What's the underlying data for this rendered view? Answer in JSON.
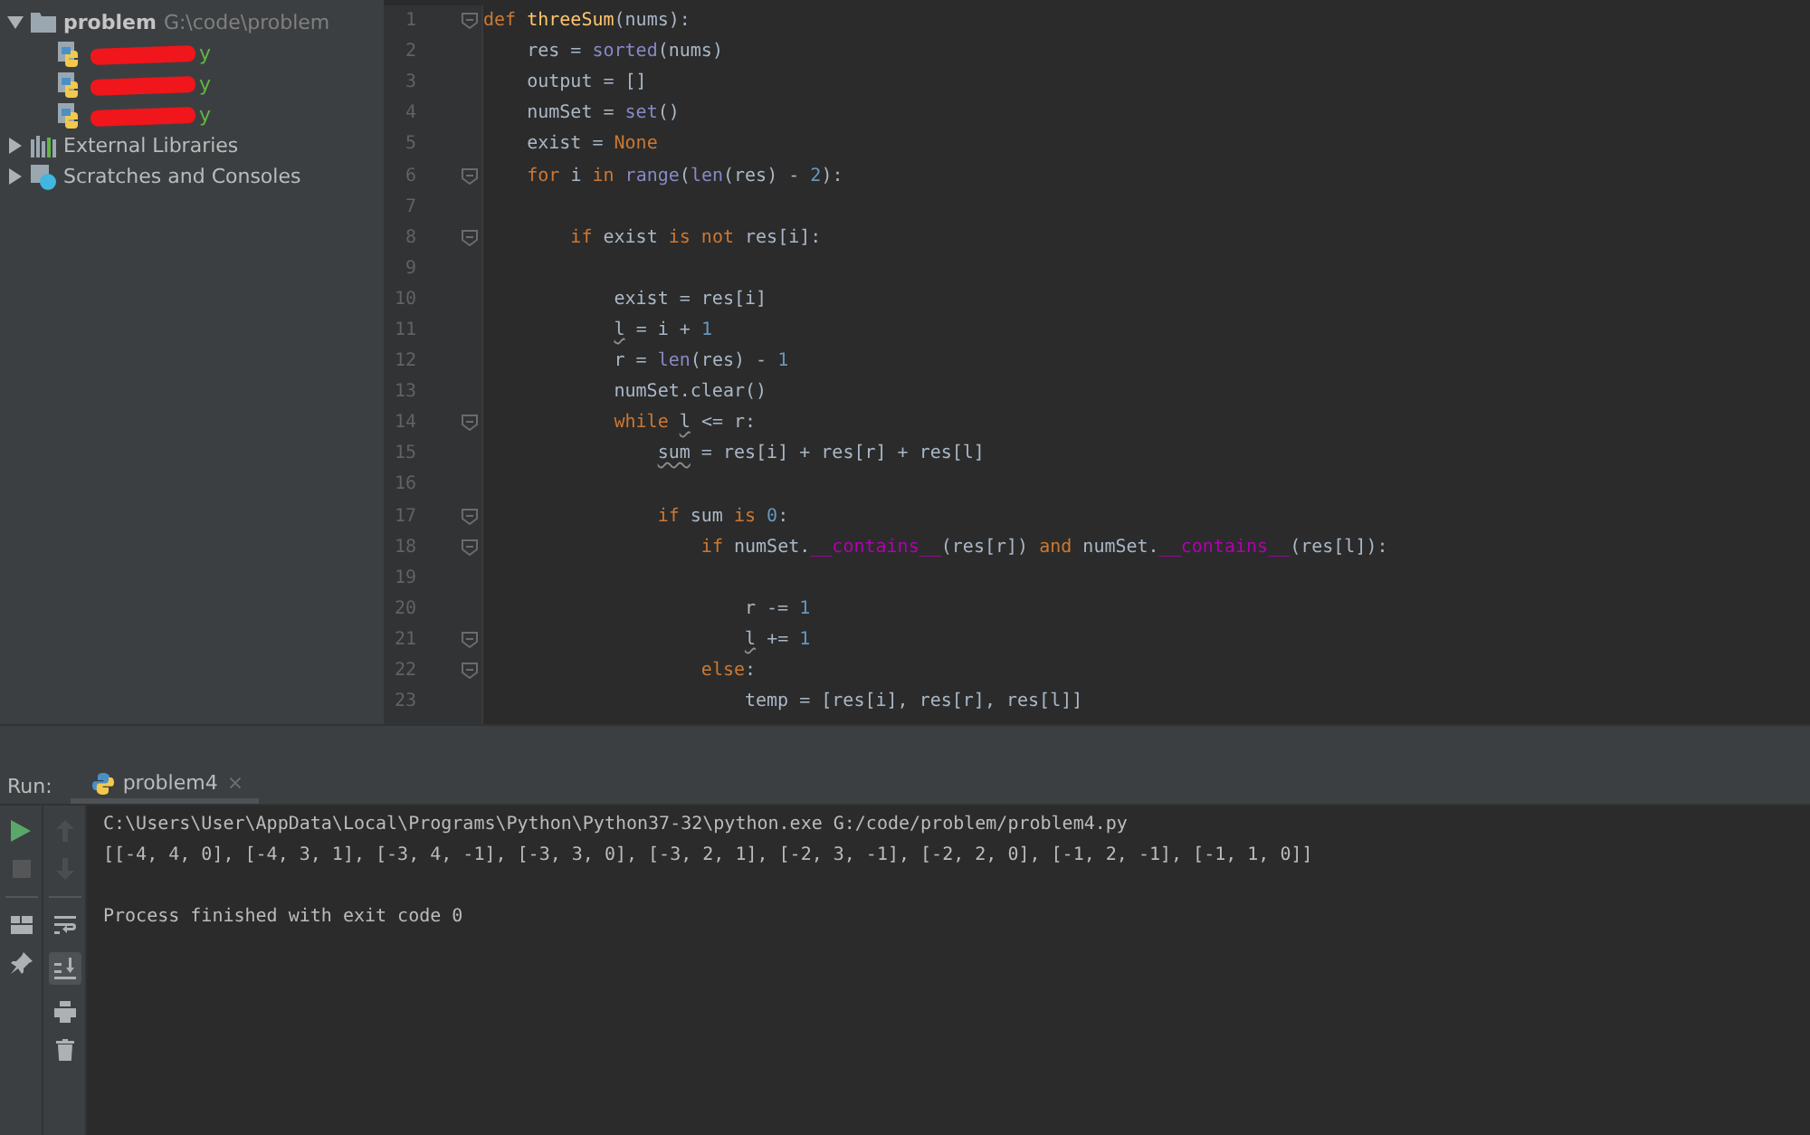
{
  "project": {
    "root": {
      "name": "problem",
      "path": "G:\\code\\problem",
      "expanded": true,
      "files": [
        {
          "visible_text": "y",
          "redacted": true
        },
        {
          "visible_text": "y",
          "redacted": true
        },
        {
          "visible_text": "y",
          "redacted": true
        }
      ]
    },
    "nodes": [
      {
        "kind": "libraries",
        "label": "External Libraries",
        "expanded": false
      },
      {
        "kind": "scratches",
        "label": "Scratches and Consoles",
        "expanded": false
      }
    ]
  },
  "editor": {
    "lines": [
      {
        "number": "1",
        "fold": true,
        "tokens": [
          {
            "t": "def ",
            "kind": "kw"
          },
          {
            "t": "threeSum",
            "kind": "def"
          },
          {
            "t": "(nums):",
            "kind": "plain"
          }
        ]
      },
      {
        "number": "2",
        "tokens": [
          {
            "t": "    res = ",
            "kind": "plain"
          },
          {
            "t": "sorted",
            "kind": "builtin"
          },
          {
            "t": "(nums)",
            "kind": "plain"
          }
        ]
      },
      {
        "number": "3",
        "tokens": [
          {
            "t": "    output = []",
            "kind": "plain"
          }
        ]
      },
      {
        "number": "4",
        "tokens": [
          {
            "t": "    numSet = ",
            "kind": "plain"
          },
          {
            "t": "set",
            "kind": "builtin"
          },
          {
            "t": "()",
            "kind": "plain"
          }
        ]
      },
      {
        "number": "5",
        "tokens": [
          {
            "t": "    exist = ",
            "kind": "plain"
          },
          {
            "t": "None",
            "kind": "kw"
          }
        ]
      },
      {
        "number": "6",
        "fold": true,
        "tokens": [
          {
            "t": "    for ",
            "kind": "kw"
          },
          {
            "t": "i ",
            "kind": "plain"
          },
          {
            "t": "in ",
            "kind": "kw"
          },
          {
            "t": "range",
            "kind": "builtin"
          },
          {
            "t": "(",
            "kind": "plain"
          },
          {
            "t": "len",
            "kind": "builtin"
          },
          {
            "t": "(res) - ",
            "kind": "plain"
          },
          {
            "t": "2",
            "kind": "num"
          },
          {
            "t": "):",
            "kind": "plain"
          }
        ]
      },
      {
        "number": "7"
      },
      {
        "number": "8",
        "fold": true,
        "tokens": [
          {
            "t": "        if ",
            "kind": "kw"
          },
          {
            "t": "exist ",
            "kind": "plain"
          },
          {
            "t": "is not ",
            "kind": "kw"
          },
          {
            "t": "res[i]:",
            "kind": "plain"
          }
        ]
      },
      {
        "number": "9"
      },
      {
        "number": "10",
        "tokens": [
          {
            "t": "            exist = res[i]",
            "kind": "plain"
          }
        ]
      },
      {
        "number": "11",
        "tokens": [
          {
            "t": "            l",
            "kind": "warn"
          },
          {
            "t": " = i + ",
            "kind": "plain"
          },
          {
            "t": "1",
            "kind": "num"
          }
        ]
      },
      {
        "number": "12",
        "tokens": [
          {
            "t": "            r = ",
            "kind": "plain"
          },
          {
            "t": "len",
            "kind": "builtin"
          },
          {
            "t": "(res) - ",
            "kind": "plain"
          },
          {
            "t": "1",
            "kind": "num"
          }
        ]
      },
      {
        "number": "13",
        "tokens": [
          {
            "t": "            numSet.clear()",
            "kind": "plain"
          }
        ]
      },
      {
        "number": "14",
        "fold": true,
        "tokens": [
          {
            "t": "            while ",
            "kind": "kw"
          },
          {
            "t": "l",
            "kind": "warn"
          },
          {
            "t": " <= r:",
            "kind": "plain"
          }
        ]
      },
      {
        "number": "15",
        "tokens": [
          {
            "t": "                sum",
            "kind": "warn"
          },
          {
            "t": " = res[i] + res[r] + res[l]",
            "kind": "plain"
          }
        ]
      },
      {
        "number": "16"
      },
      {
        "number": "17",
        "fold": true,
        "tokens": [
          {
            "t": "                if ",
            "kind": "kw"
          },
          {
            "t": "sum ",
            "kind": "plain"
          },
          {
            "t": "is ",
            "kind": "kw"
          },
          {
            "t": "0",
            "kind": "num"
          },
          {
            "t": ":",
            "kind": "plain"
          }
        ]
      },
      {
        "number": "18",
        "fold": true,
        "tokens": [
          {
            "t": "                    if ",
            "kind": "kw"
          },
          {
            "t": "numSet.",
            "kind": "plain"
          },
          {
            "t": "__contains__",
            "kind": "magic"
          },
          {
            "t": "(res[r]) ",
            "kind": "plain"
          },
          {
            "t": "and ",
            "kind": "kw"
          },
          {
            "t": "numSet.",
            "kind": "plain"
          },
          {
            "t": "__contains__",
            "kind": "magic"
          },
          {
            "t": "(res[l]):",
            "kind": "plain"
          }
        ]
      },
      {
        "number": "19"
      },
      {
        "number": "20",
        "tokens": [
          {
            "t": "                        r -= ",
            "kind": "plain"
          },
          {
            "t": "1",
            "kind": "num"
          }
        ]
      },
      {
        "number": "21",
        "fold": true,
        "tokens": [
          {
            "t": "                        l",
            "kind": "warn"
          },
          {
            "t": " += ",
            "kind": "plain"
          },
          {
            "t": "1",
            "kind": "num"
          }
        ]
      },
      {
        "number": "22",
        "fold": true,
        "tokens": [
          {
            "t": "                    else",
            "kind": "kw"
          },
          {
            "t": ":",
            "kind": "plain"
          }
        ]
      },
      {
        "number": "23",
        "tokens": [
          {
            "t": "                        temp = [res[i], res[r], res[l]]",
            "kind": "plain"
          }
        ]
      }
    ]
  },
  "run": {
    "label": "Run:",
    "tabs": [
      {
        "label": "problem4",
        "selected": true,
        "close": "×"
      }
    ],
    "output_blocks": [
      {
        "lines": [
          "C:\\Users\\User\\AppData\\Local\\Programs\\Python\\Python37-32\\python.exe G:/code/problem/problem4.py",
          "[[-4, 4, 0], [-4, 3, 1], [-3, 4, -1], [-3, 3, 0], [-3, 2, 1], [-2, 3, -1], [-2, 2, 0], [-1, 2, -1], [-1, 1, 0]]"
        ]
      },
      {
        "lines": [
          "Process finished with exit code 0"
        ]
      }
    ],
    "scroll_to_end": true
  }
}
